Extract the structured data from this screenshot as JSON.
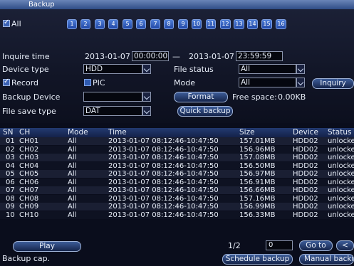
{
  "window": {
    "title": "Backup"
  },
  "channels": {
    "all_label": "All",
    "items": [
      "1",
      "2",
      "3",
      "4",
      "5",
      "6",
      "7",
      "8",
      "9",
      "10",
      "11",
      "12",
      "13",
      "14",
      "15",
      "16"
    ]
  },
  "form": {
    "inquire_time_label": "Inquire time",
    "start_date": "2013-01-07",
    "start_time": "00:00:00",
    "range_sep": "—",
    "end_date": "2013-01-07",
    "end_time": "23:59:59",
    "device_type_label": "Device type",
    "device_type_value": "HDD",
    "file_status_label": "File status",
    "file_status_value": "All",
    "record_label": "Record",
    "pic_label": "PIC",
    "mode_label": "Mode",
    "mode_value": "All",
    "inquiry_button": "Inquiry",
    "backup_device_label": "Backup Device",
    "backup_device_value": "",
    "format_button": "Format",
    "free_space_label": "Free space:",
    "free_space_value": "0.00KB",
    "file_save_type_label": "File save type",
    "file_save_type_value": "DAT",
    "quick_backup_button": "Quick backup"
  },
  "table": {
    "headers": {
      "sn": "SN",
      "ch": "CH",
      "mode": "Mode",
      "time": "Time",
      "size": "Size",
      "device": "Device",
      "status": "Status"
    },
    "rows": [
      {
        "sn": "01",
        "ch": "CH01",
        "mode": "All",
        "time": "2013-01-07 08:12:46-10:47:50",
        "size": "157.01MB",
        "device": "HDD02",
        "status": "unlocke"
      },
      {
        "sn": "02",
        "ch": "CH02",
        "mode": "All",
        "time": "2013-01-07 08:12:46-10:47:50",
        "size": "156.96MB",
        "device": "HDD02",
        "status": "unlocke"
      },
      {
        "sn": "03",
        "ch": "CH03",
        "mode": "All",
        "time": "2013-01-07 08:12:46-10:47:50",
        "size": "157.08MB",
        "device": "HDD02",
        "status": "unlocke"
      },
      {
        "sn": "04",
        "ch": "CH04",
        "mode": "All",
        "time": "2013-01-07 08:12:46-10:47:50",
        "size": "156.50MB",
        "device": "HDD02",
        "status": "unlocke"
      },
      {
        "sn": "05",
        "ch": "CH05",
        "mode": "All",
        "time": "2013-01-07 08:12:46-10:47:50",
        "size": "156.97MB",
        "device": "HDD02",
        "status": "unlocke"
      },
      {
        "sn": "06",
        "ch": "CH06",
        "mode": "All",
        "time": "2013-01-07 08:12:46-10:47:50",
        "size": "156.91MB",
        "device": "HDD02",
        "status": "unlocke"
      },
      {
        "sn": "07",
        "ch": "CH07",
        "mode": "All",
        "time": "2013-01-07 08:12:46-10:47:50",
        "size": "156.66MB",
        "device": "HDD02",
        "status": "unlocke"
      },
      {
        "sn": "08",
        "ch": "CH08",
        "mode": "All",
        "time": "2013-01-07 08:12:46-10:47:50",
        "size": "157.16MB",
        "device": "HDD02",
        "status": "unlocke"
      },
      {
        "sn": "09",
        "ch": "CH09",
        "mode": "All",
        "time": "2013-01-07 08:12:46-10:47:50",
        "size": "156.99MB",
        "device": "HDD02",
        "status": "unlocke"
      },
      {
        "sn": "10",
        "ch": "CH10",
        "mode": "All",
        "time": "2013-01-07 08:12:46-10:47:50",
        "size": "156.33MB",
        "device": "HDD02",
        "status": "unlocke"
      }
    ]
  },
  "footer": {
    "play_button": "Play",
    "backup_cap_label": "Backup cap.",
    "page_indicator": "1/2",
    "page_input": "0",
    "goto_button": "Go to",
    "prev_button": "<",
    "schedule_backup_button": "Schedule backup",
    "manual_backup_button": "Manual backu"
  },
  "colors": {
    "background": "#0a0d1c",
    "accent": "#2f4d86",
    "channel_button": "#2e5ab0"
  }
}
